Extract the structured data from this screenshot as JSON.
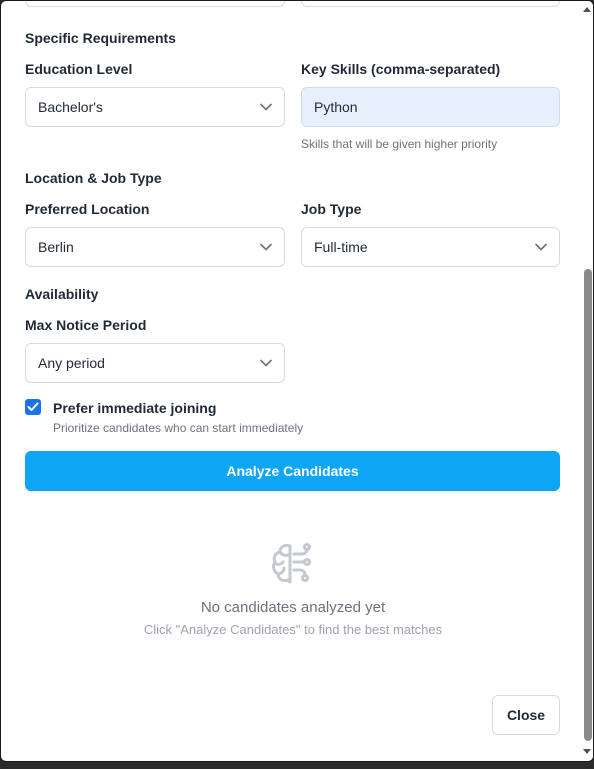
{
  "sections": {
    "specific_requirements": "Specific Requirements",
    "location_job_type": "Location & Job Type",
    "availability": "Availability"
  },
  "education": {
    "label": "Education Level",
    "value": "Bachelor's"
  },
  "key_skills": {
    "label": "Key Skills (comma-separated)",
    "value": "Python",
    "hint": "Skills that will be given higher priority"
  },
  "location": {
    "label": "Preferred Location",
    "value": "Berlin"
  },
  "job_type": {
    "label": "Job Type",
    "value": "Full-time"
  },
  "notice": {
    "label": "Max Notice Period",
    "value": "Any period"
  },
  "immediate": {
    "label": "Prefer immediate joining",
    "hint": "Prioritize candidates who can start immediately",
    "checked": true
  },
  "analyze_button": "Analyze Candidates",
  "empty_state": {
    "icon": "brain-icon",
    "title": "No candidates analyzed yet",
    "subtitle": "Click \"Analyze Candidates\" to find the best matches"
  },
  "close_button": "Close",
  "colors": {
    "primary": "#0ea5f5",
    "checkbox": "#1a73e8",
    "input_filled": "#e8f0fd"
  }
}
